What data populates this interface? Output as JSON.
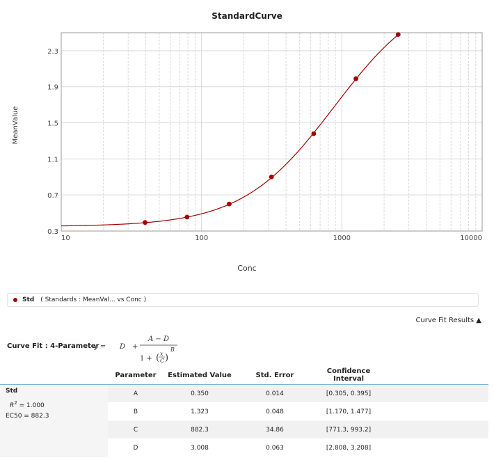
{
  "chart_data": {
    "type": "scatter",
    "title": "StandardCurve",
    "xlabel": "Conc",
    "ylabel": "MeanValue",
    "xscale": "log",
    "xlim": [
      10,
      10000
    ],
    "ylim": [
      0.3,
      2.5
    ],
    "x_ticks": [
      "10",
      "100",
      "1000",
      "10000"
    ],
    "y_ticks": [
      "0.3",
      "0.7",
      "1.1",
      "1.5",
      "1.9",
      "2.3"
    ],
    "grid": true,
    "series": [
      {
        "name": "Std",
        "x": [
          39.6,
          78.8,
          157.5,
          315,
          630,
          1260,
          2520
        ],
        "y": [
          0.395,
          0.455,
          0.6,
          0.9,
          1.38,
          1.99,
          2.48
        ]
      }
    ],
    "fit": {
      "A": 0.35,
      "B": 1.323,
      "C": 882.3,
      "D": 3.008
    },
    "colors": {
      "marker": "#a50000",
      "curve": "#a50000",
      "grid": "#d9d9d9"
    }
  },
  "legend": {
    "name": "Std",
    "desc": "( Standards : MeanVal...   vs Conc  )"
  },
  "fit_toggle": "Curve Fit Results ▲",
  "curve_fit_label": "Curve Fit : 4-Parameter",
  "formula": {
    "y": "y =",
    "d": "D",
    "plus": "+",
    "num": "A − D",
    "den_one": "1 +",
    "x": "x",
    "c": "C",
    "b": "B"
  },
  "results": {
    "headers": [
      "Parameter",
      "Estimated Value",
      "Std. Error",
      "Confidence Interval"
    ],
    "series_name": "Std",
    "r2_symbol": "R",
    "r2_exp": "2",
    "r2_value": "= 1.000",
    "ec50": "EC50 = 882.3",
    "rows": [
      [
        "A",
        "0.350",
        "0.014",
        "[0.305, 0.395]"
      ],
      [
        "B",
        "1.323",
        "0.048",
        "[1.170, 1.477]"
      ],
      [
        "C",
        "882.3",
        "34.86",
        "[771.3, 993.2]"
      ],
      [
        "D",
        "3.008",
        "0.063",
        "[2.808, 3.208]"
      ]
    ]
  }
}
